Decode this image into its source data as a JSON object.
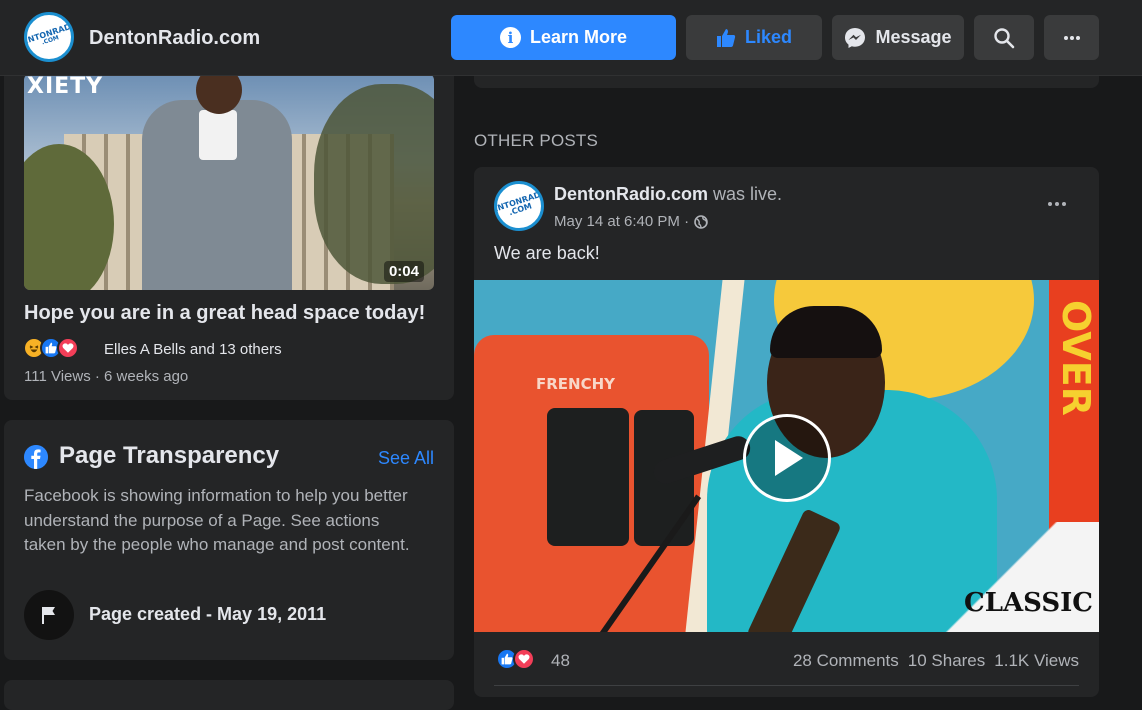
{
  "header": {
    "page_name": "DentonRadio.com",
    "logo_text": "DENTONRADIO",
    "logo_sub": ".COM",
    "buttons": {
      "learn_more": "Learn More",
      "liked": "Liked",
      "message": "Message"
    },
    "accent_color": "#2d88ff"
  },
  "left_video": {
    "overlay_text": "XIETY",
    "duration": "0:04",
    "title": "Hope you are in a great head space today!",
    "reactors": "Elles A Bells and 13 others",
    "meta": "111 Views · 6 weeks ago"
  },
  "transparency": {
    "title": "Page Transparency",
    "see_all": "See All",
    "description": "Facebook is showing information to help you better understand the purpose of a Page. See actions taken by the people who manage and post content.",
    "page_created": "Page created - May 19, 2011"
  },
  "other_posts": {
    "heading": "OTHER POSTS",
    "post": {
      "author": "DentonRadio.com",
      "action": "was live.",
      "timestamp": "May 14 at 6:40 PM ·",
      "text": "We are back!",
      "video_truck_label": "FRENCHY",
      "video_side_text": "OVER",
      "video_logo": "CLASSIC",
      "reaction_count": "48",
      "comments": "28 Comments",
      "shares": "10 Shares",
      "views": "1.1K Views"
    }
  }
}
